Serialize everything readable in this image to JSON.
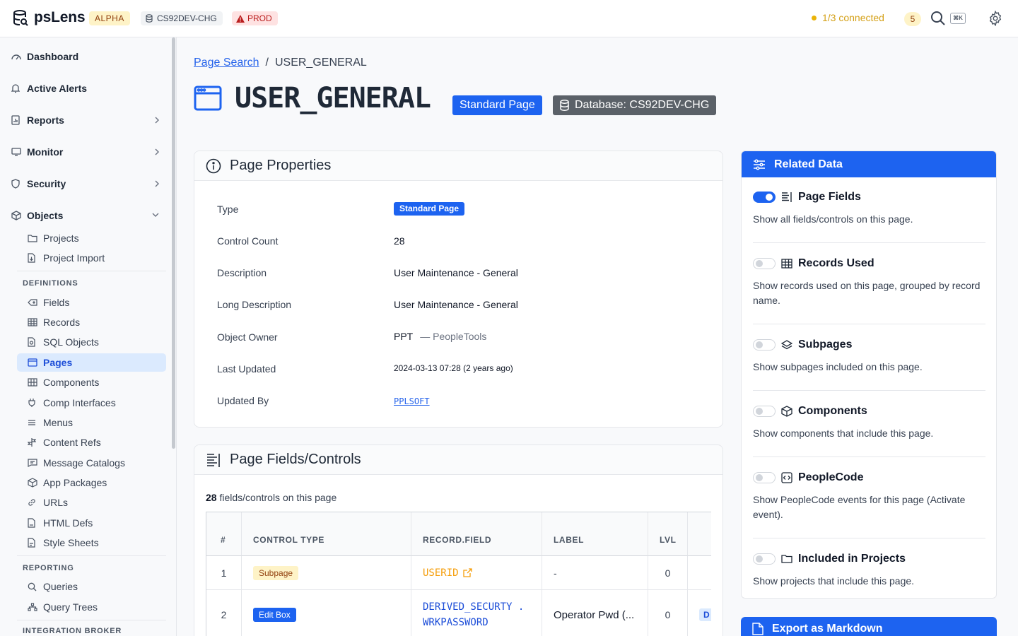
{
  "header": {
    "app_name": "psLens",
    "alpha_badge": "ALPHA",
    "db_name": "CS92DEV-CHG",
    "env_badge": "PROD",
    "connection_status": "1/3 connected",
    "notification_count": "5",
    "shortcut": "⌘K"
  },
  "sidebar": {
    "top": [
      {
        "label": "Dashboard",
        "icon": "dashboard-icon"
      },
      {
        "label": "Active Alerts",
        "icon": "bell-icon"
      },
      {
        "label": "Reports",
        "icon": "report-icon"
      },
      {
        "label": "Monitor",
        "icon": "monitor-icon"
      },
      {
        "label": "Security",
        "icon": "shield-icon"
      },
      {
        "label": "Objects",
        "icon": "cube-icon"
      }
    ],
    "objects_items": [
      "Projects",
      "Project Import"
    ],
    "definitions_title": "DEFINITIONS",
    "definitions": [
      "Fields",
      "Records",
      "SQL Objects",
      "Pages",
      "Components",
      "Comp Interfaces",
      "Menus",
      "Content Refs",
      "Message Catalogs",
      "App Packages",
      "URLs",
      "HTML Defs",
      "Style Sheets"
    ],
    "reporting_title": "REPORTING",
    "reporting": [
      "Queries",
      "Query Trees"
    ],
    "integration_title": "INTEGRATION BROKER"
  },
  "breadcrumb": {
    "parent": "Page Search",
    "separator": "/",
    "current": "USER_GENERAL"
  },
  "page": {
    "title": "USER_GENERAL",
    "type_badge": "Standard Page",
    "db_badge": "Database: CS92DEV-CHG"
  },
  "properties": {
    "title": "Page Properties",
    "rows": [
      {
        "label": "Type",
        "value": "Standard Page"
      },
      {
        "label": "Control Count",
        "value": "28"
      },
      {
        "label": "Description",
        "value": "User Maintenance - General"
      },
      {
        "label": "Long Description",
        "value": "User Maintenance - General"
      },
      {
        "label": "Object Owner",
        "value": "PPT",
        "extra": "— PeopleTools"
      },
      {
        "label": "Last Updated",
        "value": "2024-03-13 07:28 (2 years ago)"
      },
      {
        "label": "Updated By",
        "value": "PPLSOFT"
      }
    ]
  },
  "fields": {
    "title": "Page Fields/Controls",
    "count": "28",
    "count_suffix": "fields/controls on this page",
    "columns": [
      "#",
      "CONTROL TYPE",
      "RECORD.FIELD",
      "LABEL",
      "LVL"
    ],
    "rows": [
      {
        "num": "1",
        "type": "Subpage",
        "field": "USERID",
        "field_line2": "",
        "label": "-",
        "lvl": "0",
        "extra": ""
      },
      {
        "num": "2",
        "type": "Edit Box",
        "field": "DERIVED_SECURTY .",
        "field_line2": "WRKPASSWORD",
        "label": "Operator Pwd (...",
        "lvl": "0",
        "extra": "D"
      }
    ]
  },
  "related": {
    "title": "Related Data",
    "items": [
      {
        "title": "Page Fields",
        "desc": "Show all fields/controls on this page.",
        "on": true,
        "icon": "list-icon"
      },
      {
        "title": "Records Used",
        "desc": "Show records used on this page, grouped by record name.",
        "on": false,
        "icon": "table-icon"
      },
      {
        "title": "Subpages",
        "desc": "Show subpages included on this page.",
        "on": false,
        "icon": "layers-icon"
      },
      {
        "title": "Components",
        "desc": "Show components that include this page.",
        "on": false,
        "icon": "box-icon"
      },
      {
        "title": "PeopleCode",
        "desc": "Show PeopleCode events for this page (Activate event).",
        "on": false,
        "icon": "code-icon"
      },
      {
        "title": "Included in Projects",
        "desc": "Show projects that include this page.",
        "on": false,
        "icon": "folder-icon"
      }
    ]
  },
  "export": {
    "label": "Export as Markdown"
  },
  "colors": {
    "accent": "#1d63f0",
    "warning": "#eab308",
    "danger": "#b91c1c"
  }
}
